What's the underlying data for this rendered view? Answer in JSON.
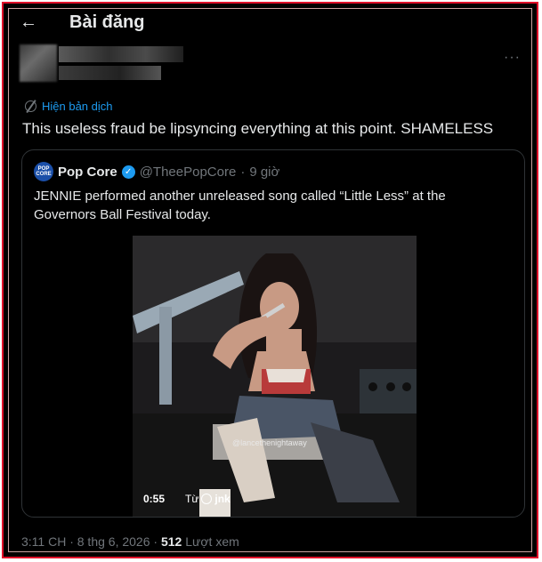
{
  "header": {
    "title": "Bài đăng",
    "back_icon": "arrow-left-icon"
  },
  "tweet": {
    "more_label": "···",
    "translate_label": "Hiện bản dịch",
    "text": "This useless fraud be lipsyncing everything at this point. SHAMELESS"
  },
  "quote": {
    "avatar_text": "POP CORE",
    "name": "Pop Core",
    "handle": "@TheePopCore",
    "separator": "·",
    "time": "9 giờ",
    "text": "JENNIE performed another unreleased song called “Little Less” at the Governors Ball Festival today.",
    "video": {
      "watermark": "@lancethenightaway",
      "duration": "0:55",
      "from_label": "Từ",
      "from_user": "jnk"
    }
  },
  "meta": {
    "timestamp": "3:11 CH · 8 thg 6, 2026 ·",
    "views_count": "512",
    "views_label": "Lượt xem"
  },
  "colors": {
    "background": "#000000",
    "accent": "#1d9bf0",
    "border": "#e0102a",
    "muted": "#71767b"
  }
}
